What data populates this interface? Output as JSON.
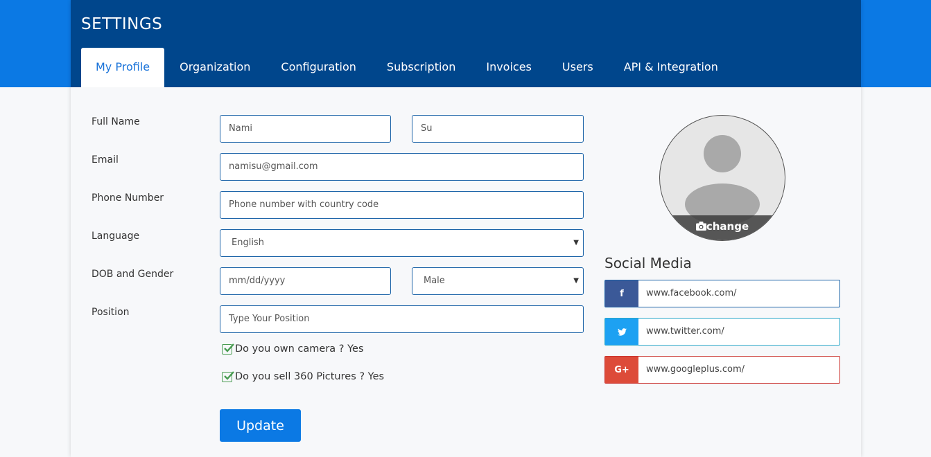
{
  "header": {
    "title": "SETTINGS",
    "tabs": [
      "My Profile",
      "Organization",
      "Configuration",
      "Subscription",
      "Invoices",
      "Users",
      "API & Integration"
    ],
    "active_tab": "My Profile"
  },
  "form": {
    "labels": {
      "full_name": "Full Name",
      "email": "Email",
      "phone": "Phone Number",
      "language": "Language",
      "dob_gender": "DOB and Gender",
      "position": "Position"
    },
    "first_name": "Nami",
    "last_name": "Su",
    "email": "namisu@gmail.com",
    "phone_placeholder": "Phone number with country code",
    "language": "English",
    "dob_placeholder": "mm/dd/yyyy",
    "gender": "Male",
    "position_placeholder": "Type Your Position",
    "checks": [
      {
        "label": "Do you own camera ? Yes",
        "checked": true
      },
      {
        "label": "Do you sell 360 Pictures ? Yes",
        "checked": true
      }
    ],
    "update_label": "Update"
  },
  "profile": {
    "change_label": "change"
  },
  "social": {
    "title": "Social Media",
    "facebook": {
      "icon": "f",
      "url": "www.facebook.com/",
      "color": "#3b5998"
    },
    "twitter": {
      "icon": "twitter-bird",
      "url": "www.twitter.com/",
      "color": "#1da1f2"
    },
    "googleplus": {
      "icon": "G+",
      "url": "www.googleplus.com/",
      "color": "#dd4b39"
    }
  },
  "colors": {
    "primary": "#0b79e4",
    "header": "#00468c",
    "check": "#4a9c52"
  }
}
